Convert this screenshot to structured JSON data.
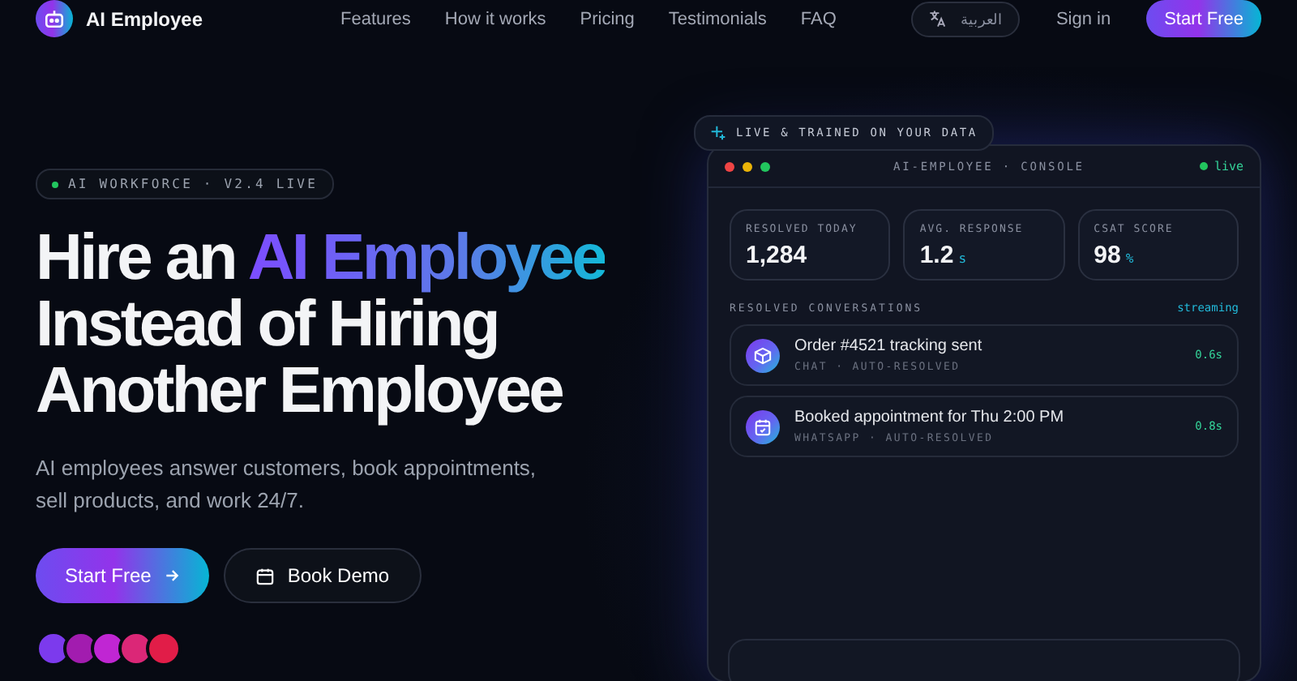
{
  "header": {
    "brand": "AI Employee",
    "nav": [
      {
        "label": "Features"
      },
      {
        "label": "How it works"
      },
      {
        "label": "Pricing"
      },
      {
        "label": "Testimonials"
      },
      {
        "label": "FAQ"
      }
    ],
    "language": "العربية",
    "sign_in": "Sign in",
    "cta": "Start Free"
  },
  "hero": {
    "badge": "AI WORKFORCE · V2.4 LIVE",
    "headline": [
      {
        "parts": [
          {
            "text": "Hire an ",
            "kind": "plain"
          },
          {
            "text": "AI Employee",
            "kind": "gradient"
          }
        ]
      },
      {
        "parts": [
          {
            "text": "Instead of Hiring",
            "kind": "plain"
          }
        ]
      },
      {
        "parts": [
          {
            "text": "Another Employee",
            "kind": "plain"
          }
        ]
      }
    ],
    "description": "AI employees answer customers, book appointments, sell products, and work 24/7.",
    "primary_button": "Start Free",
    "secondary_button": "Book Demo",
    "avatars": [
      {
        "color": "#7c3aed"
      },
      {
        "color": "#a21caf"
      },
      {
        "color": "#c026d3"
      },
      {
        "color": "#db2777"
      },
      {
        "color": "#e11d48"
      }
    ]
  },
  "console": {
    "badge": "LIVE & TRAINED ON YOUR DATA",
    "title": "AI-EMPLOYEE · CONSOLE",
    "status": "live",
    "stats": [
      {
        "label": "RESOLVED TODAY",
        "value": "1,284"
      },
      {
        "label": "AVG. RESPONSE",
        "value": "1.2",
        "unit": "s"
      },
      {
        "label": "CSAT SCORE",
        "value": "98",
        "unit": "%"
      }
    ],
    "section_title": "RESOLVED CONVERSATIONS",
    "section_status": "streaming",
    "conversations": [
      {
        "kind": "package",
        "title": "Order #4521 tracking sent",
        "meta": "CHAT · AUTO-RESOLVED",
        "time": "0.6s"
      },
      {
        "kind": "calendar",
        "title": "Booked appointment for Thu 2:00 PM",
        "meta": "WHATSAPP · AUTO-RESOLVED",
        "time": "0.8s"
      }
    ]
  }
}
